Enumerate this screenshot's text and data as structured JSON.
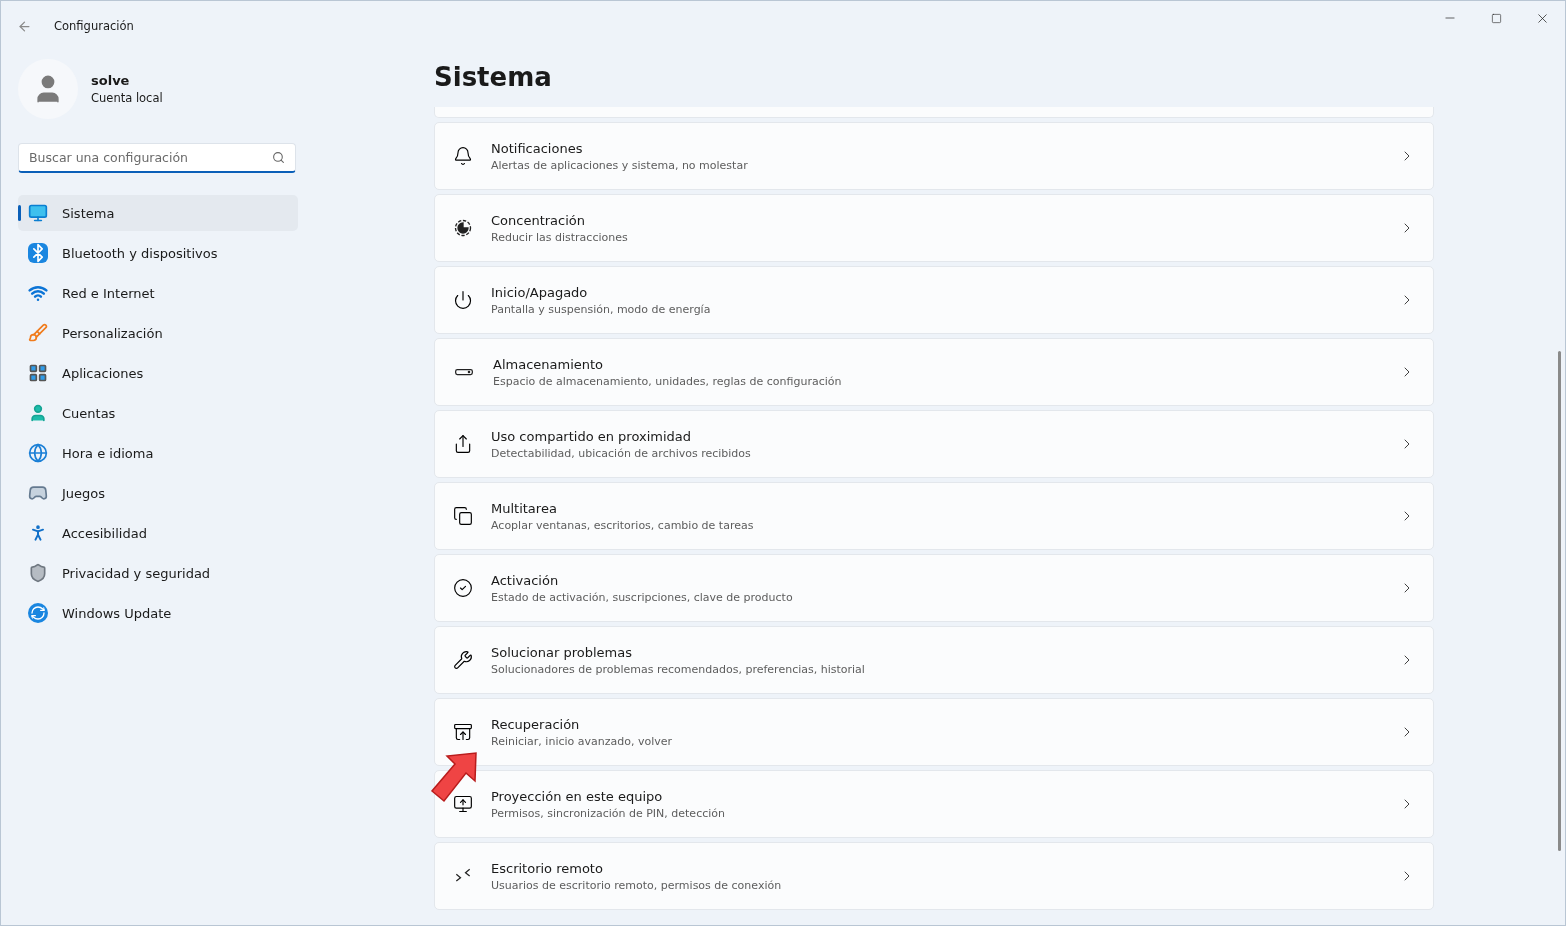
{
  "window": {
    "title": "Configuración"
  },
  "account": {
    "name": "solve",
    "type": "Cuenta local"
  },
  "search": {
    "placeholder": "Buscar una configuración"
  },
  "nav": [
    {
      "label": "Sistema",
      "selected": true
    },
    {
      "label": "Bluetooth y dispositivos",
      "selected": false
    },
    {
      "label": "Red e Internet",
      "selected": false
    },
    {
      "label": "Personalización",
      "selected": false
    },
    {
      "label": "Aplicaciones",
      "selected": false
    },
    {
      "label": "Cuentas",
      "selected": false
    },
    {
      "label": "Hora e idioma",
      "selected": false
    },
    {
      "label": "Juegos",
      "selected": false
    },
    {
      "label": "Accesibilidad",
      "selected": false
    },
    {
      "label": "Privacidad y seguridad",
      "selected": false
    },
    {
      "label": "Windows Update",
      "selected": false
    }
  ],
  "page": {
    "title": "Sistema"
  },
  "settings": [
    {
      "title": "Notificaciones",
      "subtitle": "Alertas de aplicaciones y sistema, no molestar"
    },
    {
      "title": "Concentración",
      "subtitle": "Reducir las distracciones"
    },
    {
      "title": "Inicio/Apagado",
      "subtitle": "Pantalla y suspensión, modo de energía"
    },
    {
      "title": "Almacenamiento",
      "subtitle": "Espacio de almacenamiento, unidades, reglas de configuración"
    },
    {
      "title": "Uso compartido en proximidad",
      "subtitle": "Detectabilidad, ubicación de archivos recibidos"
    },
    {
      "title": "Multitarea",
      "subtitle": "Acoplar ventanas, escritorios, cambio de tareas"
    },
    {
      "title": "Activación",
      "subtitle": "Estado de activación, suscripciones, clave de producto"
    },
    {
      "title": "Solucionar problemas",
      "subtitle": "Solucionadores de problemas recomendados, preferencias, historial"
    },
    {
      "title": "Recuperación",
      "subtitle": "Reiniciar, inicio avanzado, volver"
    },
    {
      "title": "Proyección en este equipo",
      "subtitle": "Permisos, sincronización de PIN, detección"
    },
    {
      "title": "Escritorio remoto",
      "subtitle": "Usuarios de escritorio remoto, permisos de conexión"
    }
  ]
}
